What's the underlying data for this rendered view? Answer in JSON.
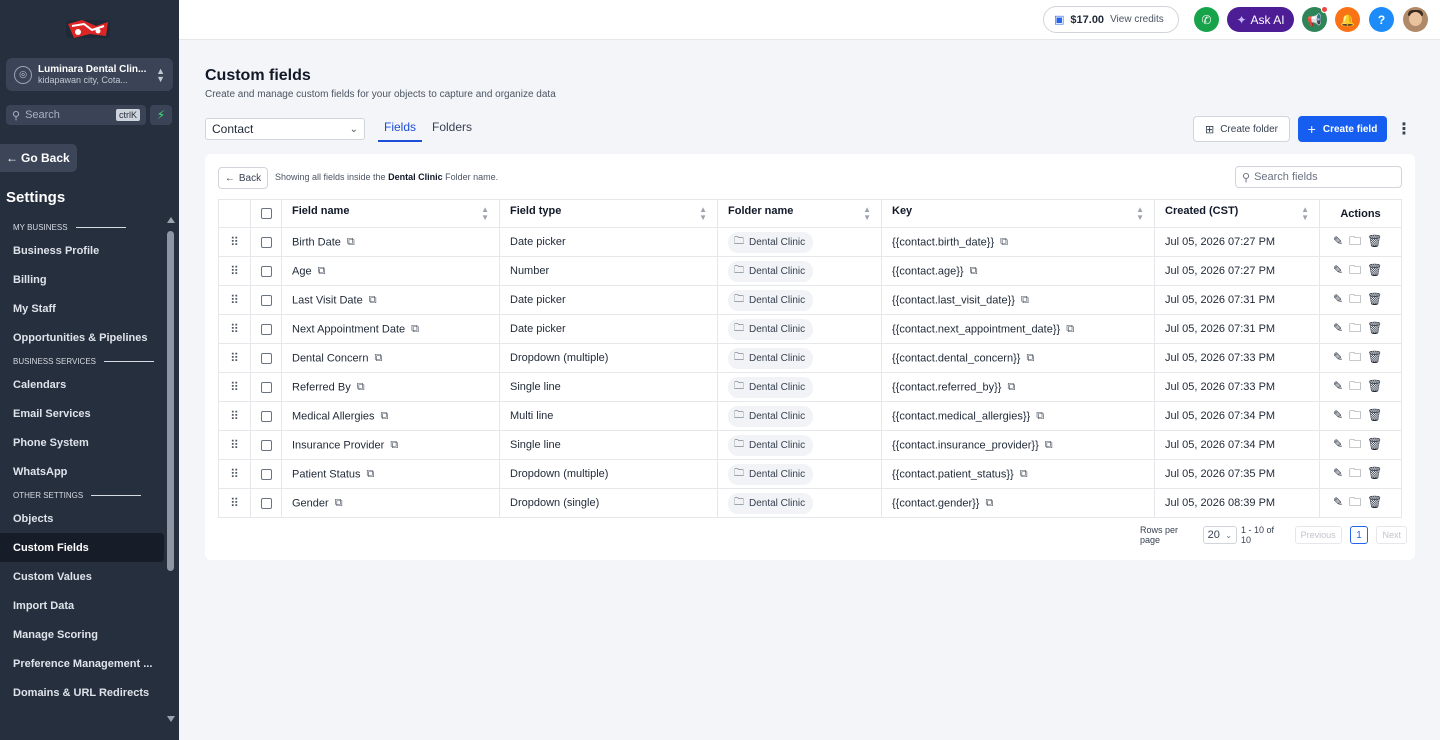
{
  "sidebar": {
    "account_name": "Luminara Dental Clin...",
    "account_location": "kidapawan city, Cota...",
    "search_placeholder": "Search",
    "search_shortcut": "ctrlK",
    "go_back": "Go Back",
    "settings_title": "Settings",
    "sections": [
      {
        "title": "MY BUSINESS",
        "items": [
          "Business Profile",
          "Billing",
          "My Staff",
          "Opportunities & Pipelines"
        ]
      },
      {
        "title": "BUSINESS SERVICES",
        "items": [
          "Calendars",
          "Email Services",
          "Phone System",
          "WhatsApp"
        ]
      },
      {
        "title": "OTHER SETTINGS",
        "items": [
          "Objects",
          "Custom Fields",
          "Custom Values",
          "Import Data",
          "Manage Scoring",
          "Preference Management ...",
          "Domains & URL Redirects"
        ]
      }
    ],
    "active_item": "Custom Fields"
  },
  "topbar": {
    "credits_amount": "$17.00",
    "credits_link": "View credits",
    "ask_ai": "Ask AI",
    "colors": {
      "phone": "#16a34a",
      "ask_ai": "#4c1d95",
      "megaphone": "#2f855a",
      "bell": "#f97316",
      "help": "#1d8cf8"
    }
  },
  "page": {
    "title": "Custom fields",
    "subtitle": "Create and manage custom fields for your objects to capture and organize data",
    "object_select": "Contact",
    "tabs": [
      "Fields",
      "Folders"
    ],
    "active_tab": "Fields",
    "create_folder": "Create folder",
    "create_field": "Create field"
  },
  "card": {
    "back": "Back",
    "showing_prefix": "Showing all fields inside the",
    "showing_folder": "Dental Clinic",
    "showing_suffix": "Folder name.",
    "search_placeholder": "Search fields"
  },
  "table": {
    "columns": [
      "Field name",
      "Field type",
      "Folder name",
      "Key",
      "Created (CST)",
      "Actions"
    ],
    "rows": [
      {
        "name": "Birth Date",
        "type": "Date picker",
        "folder": "Dental Clinic",
        "key": "{{contact.birth_date}}",
        "created": "Jul 05, 2026 07:27 PM"
      },
      {
        "name": "Age",
        "type": "Number",
        "folder": "Dental Clinic",
        "key": "{{contact.age}}",
        "created": "Jul 05, 2026 07:27 PM"
      },
      {
        "name": "Last Visit Date",
        "type": "Date picker",
        "folder": "Dental Clinic",
        "key": "{{contact.last_visit_date}}",
        "created": "Jul 05, 2026 07:31 PM"
      },
      {
        "name": "Next Appointment Date",
        "type": "Date picker",
        "folder": "Dental Clinic",
        "key": "{{contact.next_appointment_date}}",
        "created": "Jul 05, 2026 07:31 PM"
      },
      {
        "name": "Dental Concern",
        "type": "Dropdown (multiple)",
        "folder": "Dental Clinic",
        "key": "{{contact.dental_concern}}",
        "created": "Jul 05, 2026 07:33 PM"
      },
      {
        "name": "Referred By",
        "type": "Single line",
        "folder": "Dental Clinic",
        "key": "{{contact.referred_by}}",
        "created": "Jul 05, 2026 07:33 PM"
      },
      {
        "name": "Medical Allergies",
        "type": "Multi line",
        "folder": "Dental Clinic",
        "key": "{{contact.medical_allergies}}",
        "created": "Jul 05, 2026 07:34 PM"
      },
      {
        "name": "Insurance Provider",
        "type": "Single line",
        "folder": "Dental Clinic",
        "key": "{{contact.insurance_provider}}",
        "created": "Jul 05, 2026 07:34 PM"
      },
      {
        "name": "Patient Status",
        "type": "Dropdown (multiple)",
        "folder": "Dental Clinic",
        "key": "{{contact.patient_status}}",
        "created": "Jul 05, 2026 07:35 PM"
      },
      {
        "name": "Gender",
        "type": "Dropdown (single)",
        "folder": "Dental Clinic",
        "key": "{{contact.gender}}",
        "created": "Jul 05, 2026 08:39 PM"
      }
    ]
  },
  "pagination": {
    "rows_per_page_label": "Rows per page",
    "rows_per_page": "20",
    "range": "1 - 10 of 10",
    "previous": "Previous",
    "current_page": "1",
    "next": "Next"
  }
}
